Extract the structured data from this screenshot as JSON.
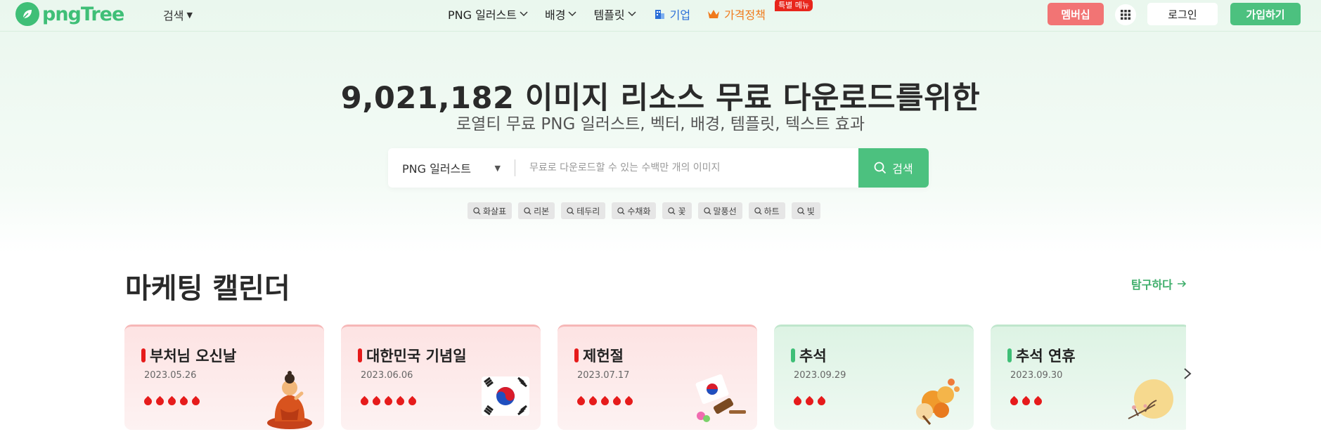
{
  "header": {
    "logo_text": "pngTree",
    "search_menu": "검색",
    "nav": [
      {
        "label": "PNG 일러스트",
        "chevron": true
      },
      {
        "label": "배경",
        "chevron": true
      },
      {
        "label": "템플릿",
        "chevron": true
      },
      {
        "label": "기업",
        "icon": "building-icon"
      },
      {
        "label": "가격정책",
        "icon": "crown-icon",
        "badge": "특별 메뉴"
      }
    ],
    "membership_button": "멤버십",
    "apps_icon": "grid-icon",
    "login_button": "로그인",
    "signup_button": "가입하기",
    "colors": {
      "brand": "#3fbf77",
      "membership": "#f27474",
      "business": "#2c6fd8",
      "pricing": "#f07a1c"
    }
  },
  "hero": {
    "title": "9,021,182 이미지 리소스 무료 다운로드를위한",
    "subtitle": "로열티 무료 PNG 일러스트, 벡터, 배경, 템플릿, 텍스트 효과"
  },
  "search": {
    "type_selected": "PNG 일러스트",
    "placeholder": "무료로 다운로드할 수 있는 수백만 개의 이미지",
    "button": "검색"
  },
  "tags": [
    "화살표",
    "리본",
    "테두리",
    "수채화",
    "꽃",
    "말풍선",
    "하트",
    "빛"
  ],
  "calendar": {
    "title": "마케팅 캘린더",
    "explore_link": "탐구하다",
    "cards": [
      {
        "title": "부처님 오신날",
        "date": "2023.05.26",
        "drops": 5,
        "theme": "red",
        "art": "buddha-illustration"
      },
      {
        "title": "대한민국 기념일",
        "date": "2023.06.06",
        "drops": 5,
        "theme": "red",
        "art": "taegukgi-illustration"
      },
      {
        "title": "제헌절",
        "date": "2023.07.17",
        "drops": 5,
        "theme": "red",
        "art": "constitution-illustration"
      },
      {
        "title": "추석",
        "date": "2023.09.29",
        "drops": 3,
        "theme": "green",
        "art": "flowers-illustration"
      },
      {
        "title": "추석 연휴",
        "date": "2023.09.30",
        "drops": 3,
        "theme": "green",
        "art": "moon-illustration"
      }
    ]
  }
}
